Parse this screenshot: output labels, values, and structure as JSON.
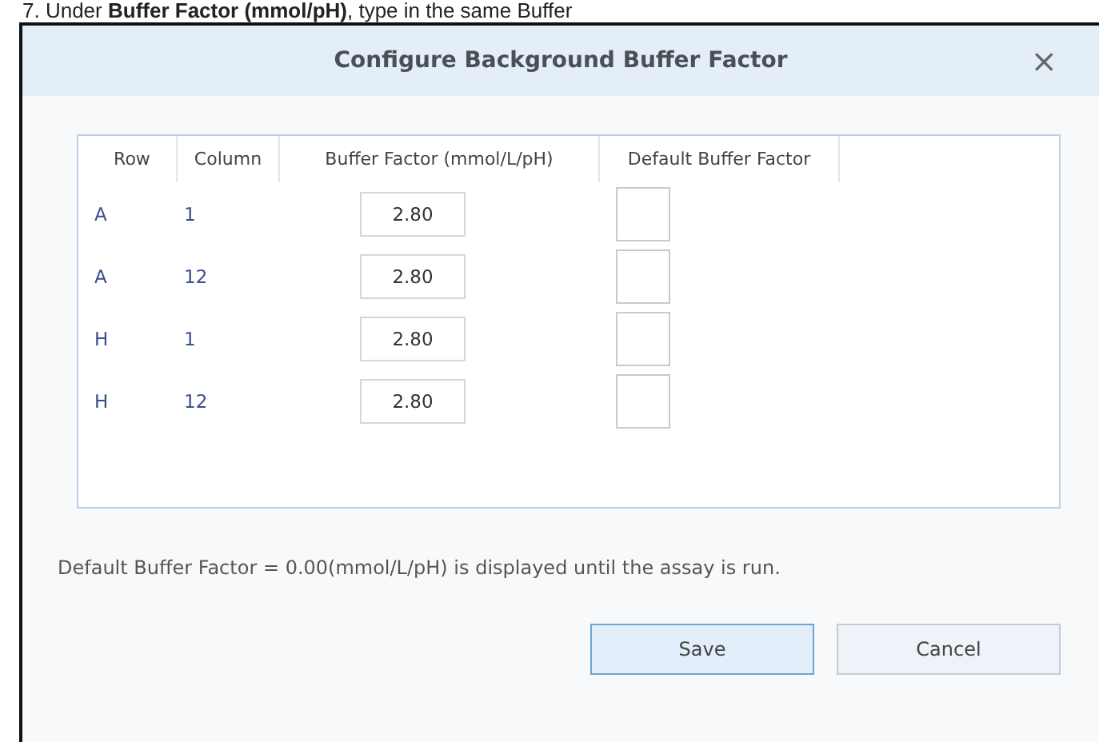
{
  "document_text": "7. Under **Buffer Factor (mmol/pH)**, type in the same Buffer",
  "dialog": {
    "title": "Configure Background Buffer Factor",
    "close": "×",
    "table": {
      "columns": [
        "Row",
        "Column",
        "Buffer Factor (mmol/L/pH)",
        "Default Buffer Factor"
      ],
      "rows": [
        {
          "row": "A",
          "column": "1",
          "buffer_factor": "2.80",
          "default_checked": false
        },
        {
          "row": "A",
          "column": "12",
          "buffer_factor": "2.80",
          "default_checked": false
        },
        {
          "row": "H",
          "column": "1",
          "buffer_factor": "2.80",
          "default_checked": false
        },
        {
          "row": "H",
          "column": "12",
          "buffer_factor": "2.80",
          "default_checked": false
        }
      ]
    },
    "note": "Default Buffer Factor = 0.00(mmol/L/pH) is displayed until the assay is run.",
    "buttons": [
      {
        "label": "Save",
        "kind": "primary"
      },
      {
        "label": "Cancel",
        "kind": "secondary"
      }
    ]
  }
}
